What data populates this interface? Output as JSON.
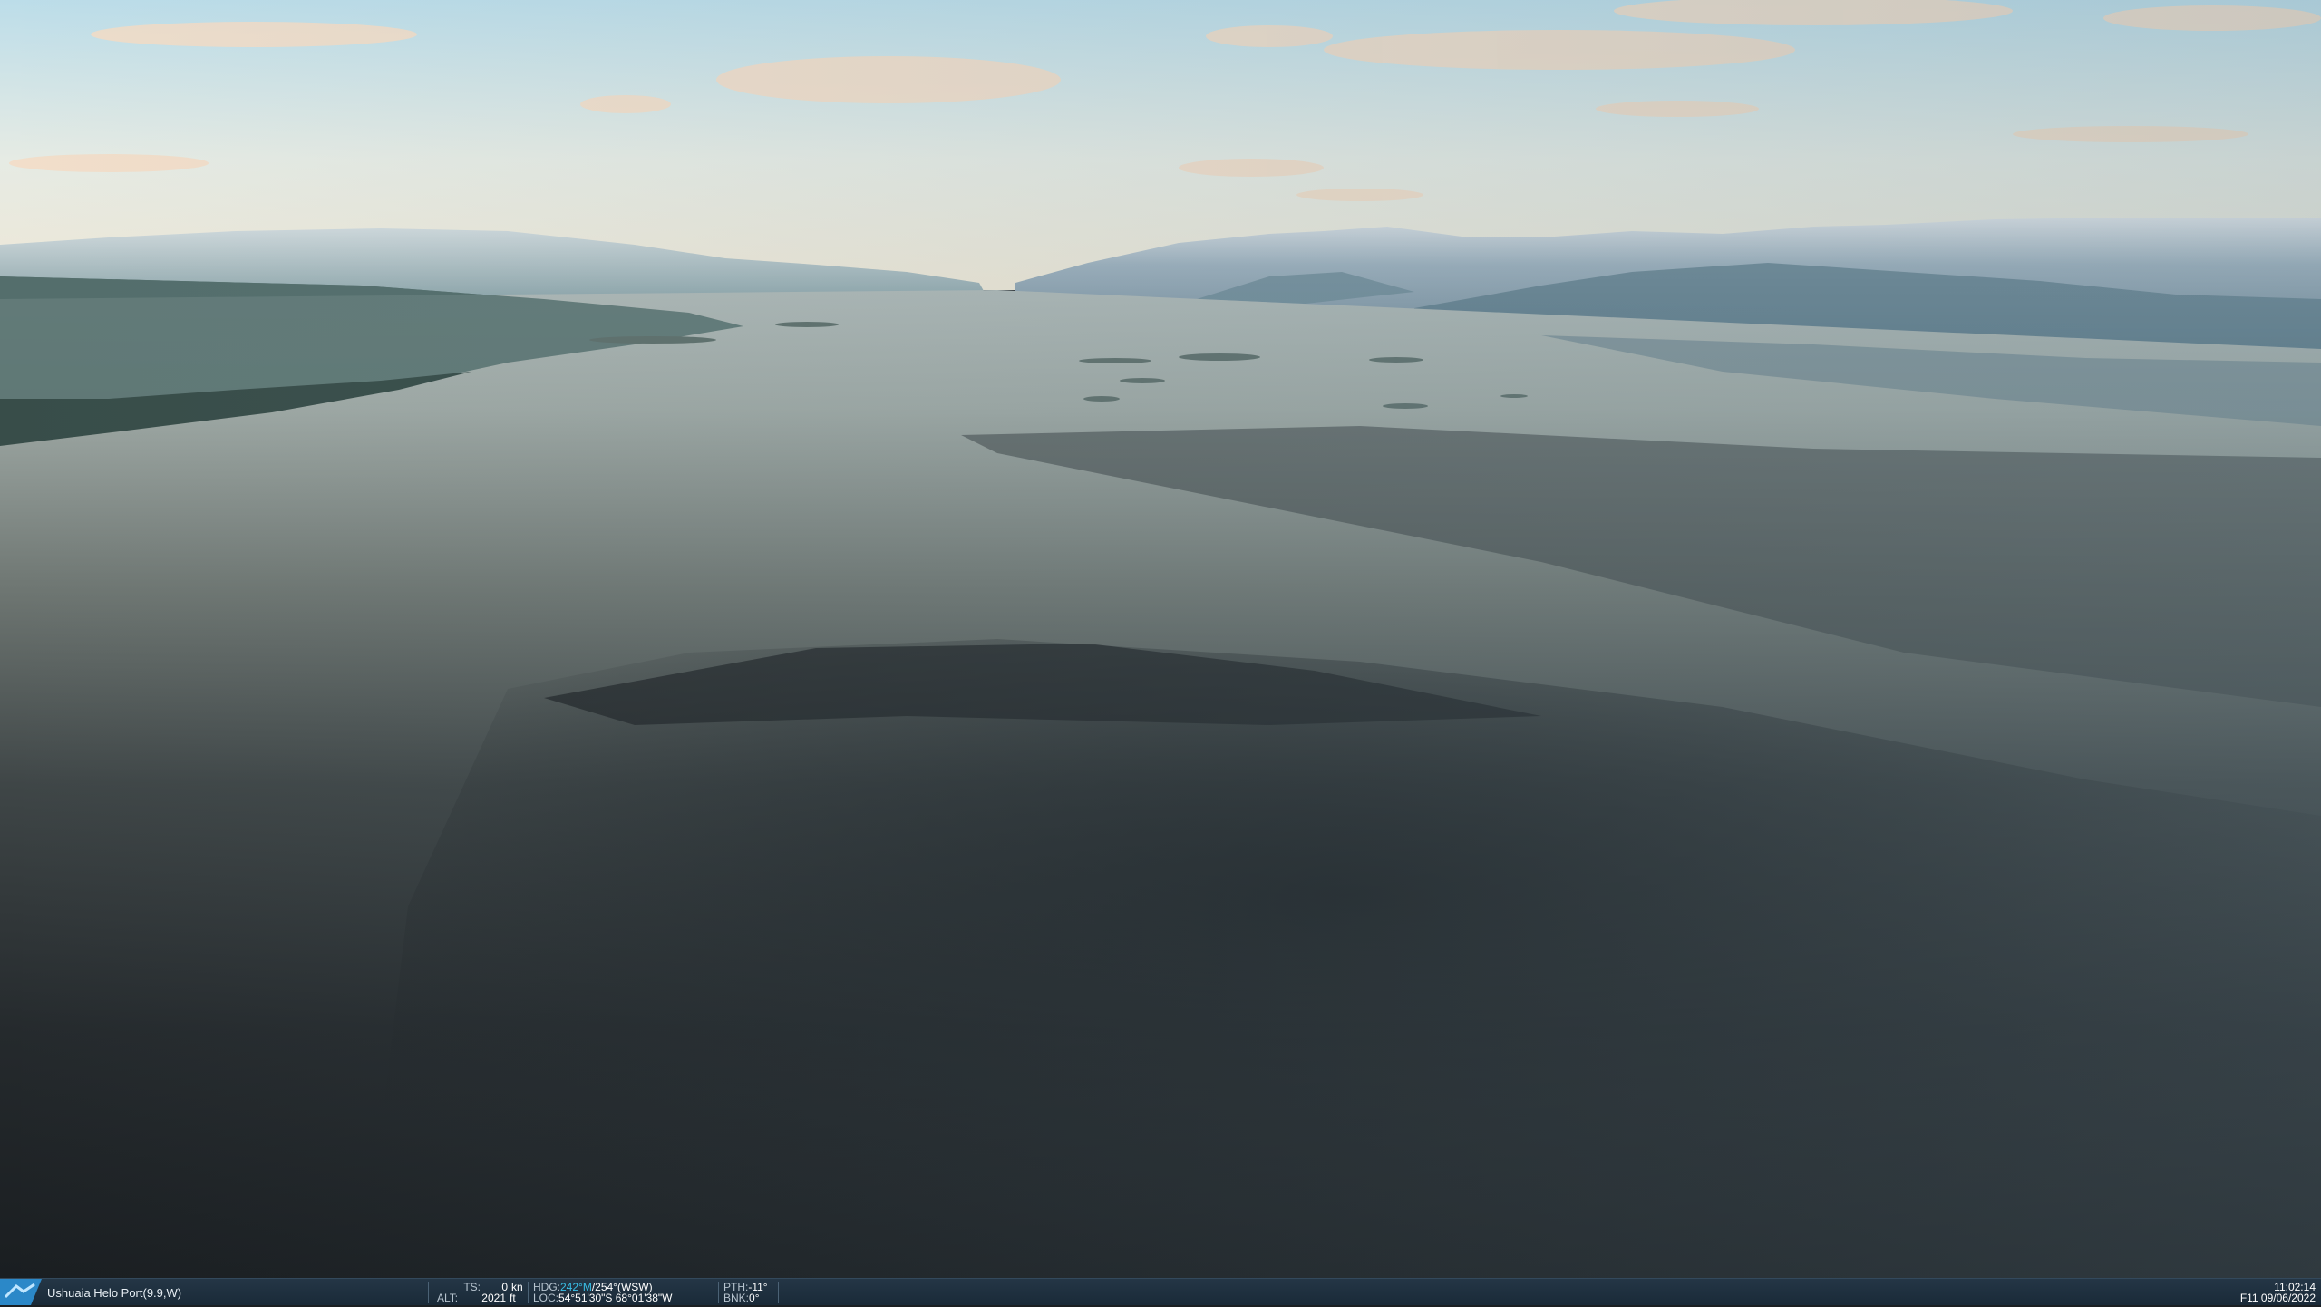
{
  "scene": {
    "description_icon": "flight-sim-3d-view"
  },
  "status_bar": {
    "location": "Ushuaia Helo Port(9.9,W)",
    "ts_label": "TS:",
    "ts_value": "0",
    "ts_unit": "kn",
    "alt_label": "ALT:",
    "alt_value": "2021",
    "alt_unit": "ft",
    "hdg_label": "HDG:",
    "hdg_magnetic": "242°M",
    "hdg_true": "/254°(WSW)",
    "loc_label": "LOC:",
    "loc_value": "54°51'30\"S 68°01'38\"W",
    "pth_label": "PTH:",
    "pth_value": "-11°",
    "bnk_label": "BNK:",
    "bnk_value": "0°",
    "time": "11:02:14",
    "date": "F11 09/06/2022"
  },
  "colors": {
    "accent": "#39c0e8",
    "bar_bg": "#1f3140"
  }
}
